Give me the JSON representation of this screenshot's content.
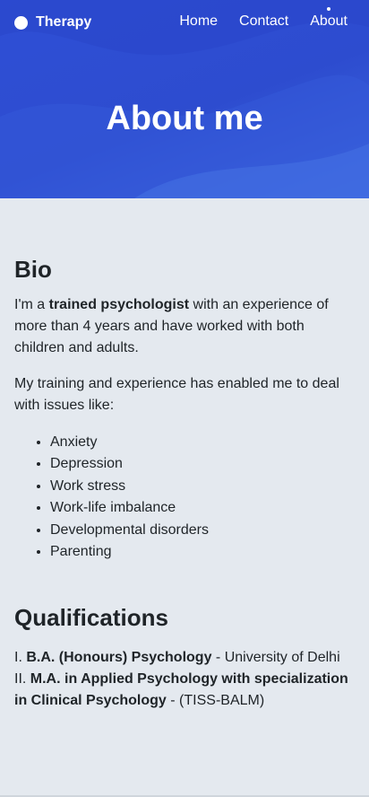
{
  "nav": {
    "brand": "Therapy",
    "links": [
      {
        "label": "Home"
      },
      {
        "label": "Contact"
      },
      {
        "label": "About",
        "active": true
      }
    ]
  },
  "hero": {
    "title": "About me"
  },
  "bio": {
    "heading": "Bio",
    "p1_pre": "I'm a ",
    "p1_bold": "trained psychologist",
    "p1_post": " with an experience of more than 4 years and have worked with both children and adults.",
    "p2": "My training and experience has enabled me to deal with issues like:",
    "issues": [
      "Anxiety",
      "Depression",
      "Work stress",
      "Work-life imbalance",
      "Developmental disorders",
      "Parenting"
    ]
  },
  "qualifications": {
    "heading": "Qualifications",
    "items": [
      {
        "numeral": "I. ",
        "bold": "B.A. (Honours) Psychology",
        "rest": " - University of Delhi"
      },
      {
        "numeral": "II. ",
        "bold": "M.A. in Applied Psychology with specialization in Clinical Psychology",
        "rest": " - (TISS-BALM)"
      }
    ]
  },
  "colors": {
    "hero_blue": "#2f4fd6",
    "page_bg": "#e4e9ef",
    "text": "#1f2428"
  }
}
